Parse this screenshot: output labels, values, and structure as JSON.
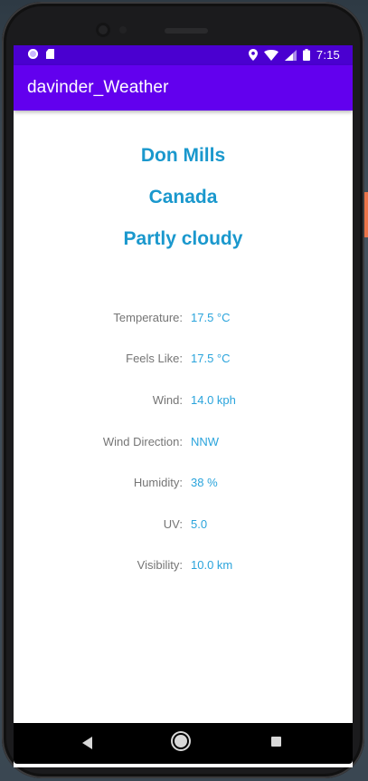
{
  "status_bar": {
    "time": "7:15",
    "icons": [
      "notification-dot-icon",
      "sd-card-icon",
      "location-icon",
      "wifi-icon",
      "signal-icon",
      "battery-icon"
    ]
  },
  "app_bar": {
    "title": "davinder_Weather"
  },
  "location": {
    "city": "Don Mills",
    "country": "Canada",
    "condition": "Partly cloudy"
  },
  "details": [
    {
      "label": "Temperature:",
      "value": "17.5 °C"
    },
    {
      "label": "Feels Like:",
      "value": "17.5 °C"
    },
    {
      "label": "Wind:",
      "value": "14.0 kph"
    },
    {
      "label": "Wind Direction:",
      "value": "NNW"
    },
    {
      "label": "Humidity:",
      "value": "38 %"
    },
    {
      "label": "UV:",
      "value": "5.0"
    },
    {
      "label": "Visibility:",
      "value": "10.0 km"
    }
  ],
  "nav_bar": {
    "icons": [
      "back-icon",
      "home-icon",
      "recents-icon"
    ]
  },
  "colors": {
    "app_bar": "#6200ee",
    "status_bar": "#4a00d0",
    "heading_text": "#1a98cd",
    "value_text": "#2aa4dc",
    "label_text": "#757575"
  }
}
